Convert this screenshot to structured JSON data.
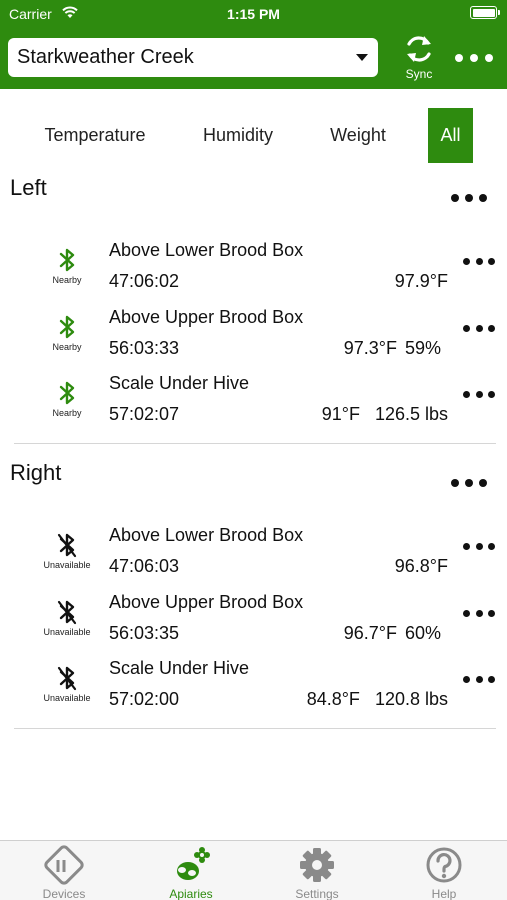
{
  "status_bar": {
    "carrier": "Carrier",
    "time": "1:15 PM"
  },
  "header": {
    "apiary_selected": "Starkweather Creek",
    "sync_label": "Sync"
  },
  "filters": [
    {
      "label": "Temperature",
      "active": false
    },
    {
      "label": "Humidity",
      "active": false
    },
    {
      "label": "Weight",
      "active": false
    },
    {
      "label": "All",
      "active": true
    }
  ],
  "sections": [
    {
      "title": "Left",
      "sensors": [
        {
          "name": "Above Lower Brood Box",
          "time": "47:06:02",
          "temp": "97.9°F",
          "humidity": "",
          "weight": "",
          "status": "Nearby",
          "icon": "bluetooth-icon"
        },
        {
          "name": "Above Upper Brood Box",
          "time": "56:03:33",
          "temp": "97.3°F",
          "humidity": "59%",
          "weight": "",
          "status": "Nearby",
          "icon": "bluetooth-icon"
        },
        {
          "name": "Scale Under Hive",
          "time": "57:02:07",
          "temp": "91°F",
          "humidity": "",
          "weight": "126.5 lbs",
          "status": "Nearby",
          "icon": "bluetooth-icon"
        }
      ]
    },
    {
      "title": "Right",
      "sensors": [
        {
          "name": "Above Lower Brood Box",
          "time": "47:06:03",
          "temp": "96.8°F",
          "humidity": "",
          "weight": "",
          "status": "Unavailable",
          "icon": "bluetooth-off-icon"
        },
        {
          "name": "Above Upper Brood Box",
          "time": "56:03:35",
          "temp": "96.7°F",
          "humidity": "60%",
          "weight": "",
          "status": "Unavailable",
          "icon": "bluetooth-off-icon"
        },
        {
          "name": "Scale Under Hive",
          "time": "57:02:00",
          "temp": "84.8°F",
          "humidity": "",
          "weight": "120.8 lbs",
          "status": "Unavailable",
          "icon": "bluetooth-off-icon"
        }
      ]
    }
  ],
  "tabbar": [
    {
      "label": "Devices",
      "icon": "devices-icon",
      "active": false
    },
    {
      "label": "Apiaries",
      "icon": "apiaries-icon",
      "active": true
    },
    {
      "label": "Settings",
      "icon": "gear-icon",
      "active": false
    },
    {
      "label": "Help",
      "icon": "help-icon",
      "active": false
    }
  ],
  "colors": {
    "brand_green": "#2e8b0f",
    "nearby_icon": "#2e8b0f",
    "unavailable_icon": "#111111",
    "tab_inactive": "#8a8a8a"
  }
}
